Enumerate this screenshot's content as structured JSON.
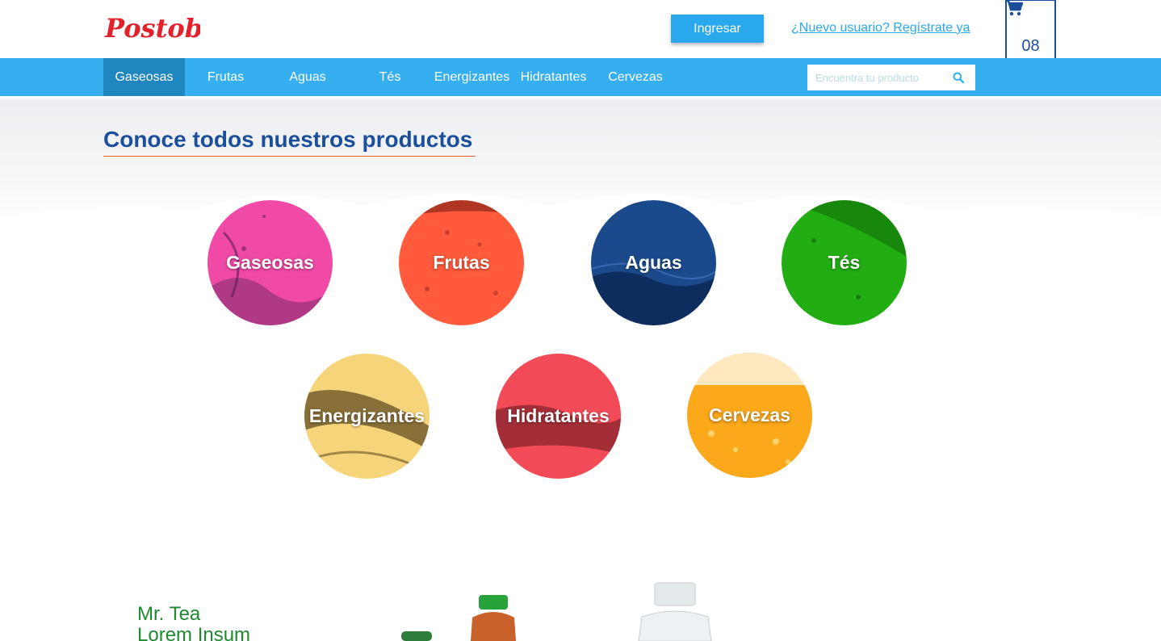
{
  "header": {
    "brand": "Postobón",
    "login_label": "Ingresar",
    "register_label": "¿Nuevo usuario? Regístrate ya",
    "cart_count": "08"
  },
  "nav": {
    "items": [
      {
        "label": "Gaseosas",
        "active": true
      },
      {
        "label": "Frutas",
        "active": false
      },
      {
        "label": "Aguas",
        "active": false
      },
      {
        "label": "Tés",
        "active": false
      },
      {
        "label": "Energizantes",
        "active": false
      },
      {
        "label": "Hidratantes",
        "active": false
      },
      {
        "label": "Cervezas",
        "active": false
      }
    ],
    "search_placeholder": "Encuentra tu producto"
  },
  "main": {
    "title": "Conoce todos nuestros productos",
    "categories": [
      {
        "label": "Gaseosas",
        "color": "#f04aa6"
      },
      {
        "label": "Frutas",
        "color": "#ff5a3c"
      },
      {
        "label": "Aguas",
        "color": "#1a4a8c"
      },
      {
        "label": "Tés",
        "color": "#22ad12"
      },
      {
        "label": "Energizantes",
        "color": "#f6d57a"
      },
      {
        "label": "Hidratantes",
        "color": "#f24b57"
      },
      {
        "label": "Cervezas",
        "color": "#fba81a"
      }
    ]
  },
  "featured": {
    "title": "Mr. Tea",
    "subtitle": "Lorem Insum"
  },
  "colors": {
    "nav_bg": "#36aff0",
    "nav_active": "#1f86c0",
    "title": "#1b4f9c",
    "brand_red": "#e4202b"
  }
}
